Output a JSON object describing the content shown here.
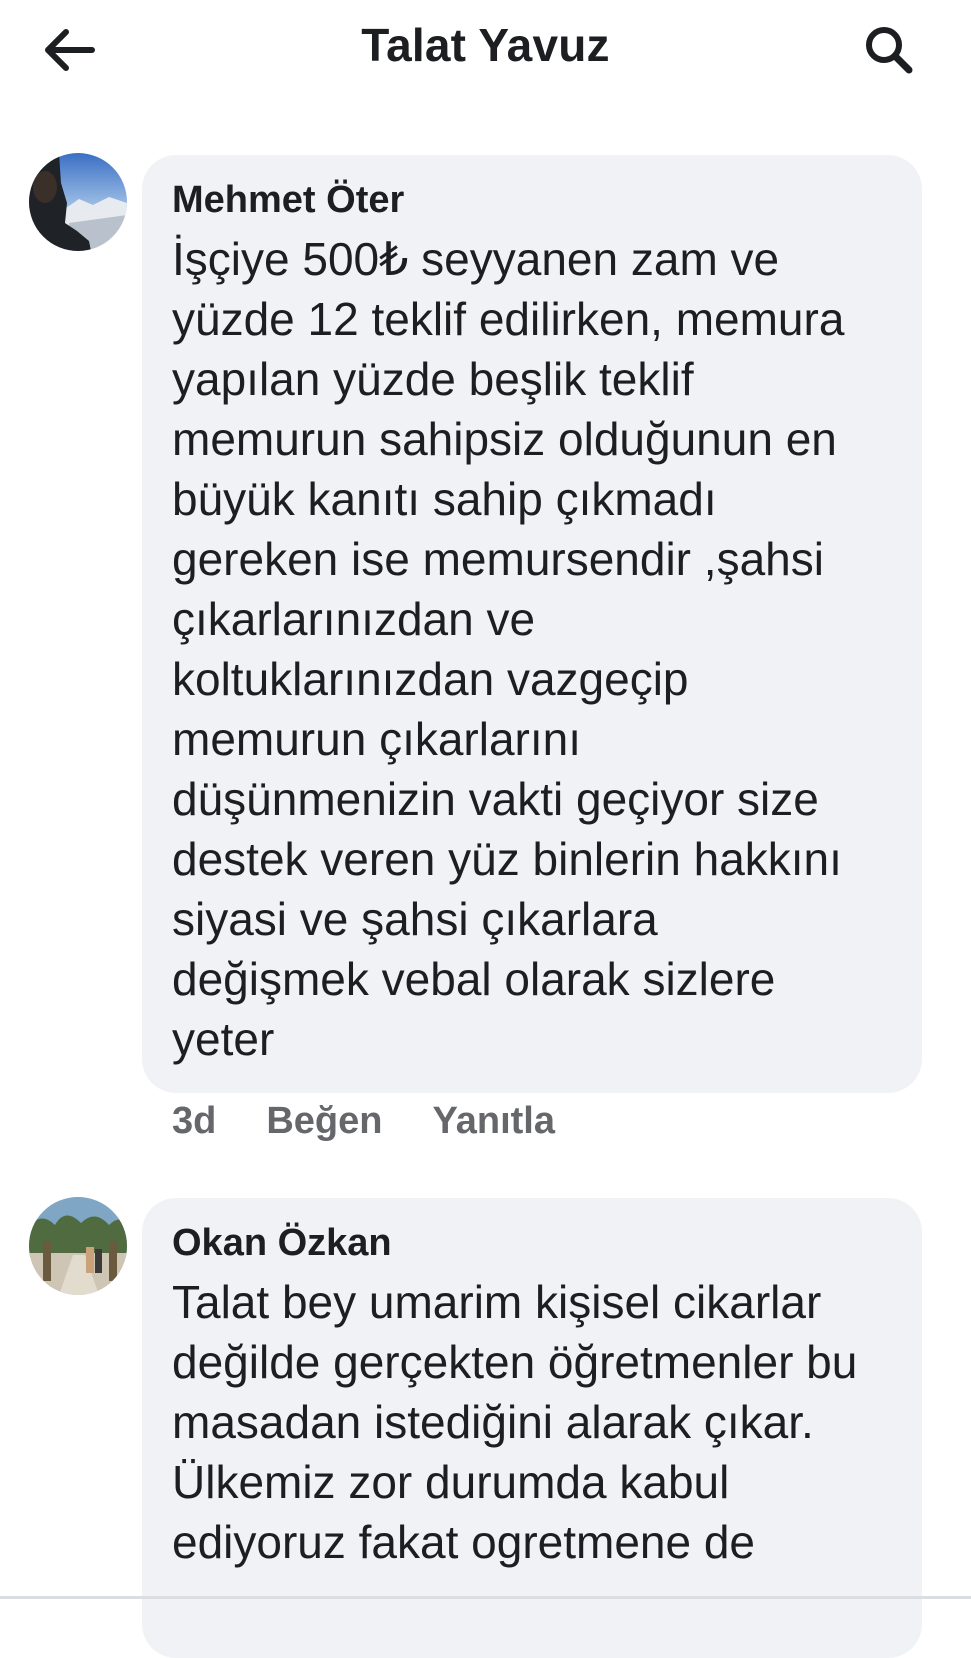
{
  "header": {
    "title": "Talat Yavuz",
    "back_icon": "arrow-left-icon",
    "search_icon": "search-icon"
  },
  "comments": [
    {
      "author": "Mehmet Öter",
      "text": "İşçiye 500₺ seyyanen zam ve\nyüzde 12 teklif edilirken, memura\nyapılan  yüzde beşlik teklif\nmemurun sahipsiz olduğunun en\nbüyük kanıtı sahip çıkmadı\ngereken ise memursendir ,şahsi\nçıkarlarınızdan ve\nkoltuklarınızdan vazgeçip\nmemurun çıkarlarını\ndüşünmenizin vakti geçiyor size\ndestek veren yüz binlerin hakkını\nsiyasi ve şahsi çıkarlara\ndeğişmek vebal olarak sizlere\nyeter",
      "time": "3d",
      "like_label": "Beğen",
      "reply_label": "Yanıtla"
    },
    {
      "author": "Okan Özkan",
      "text": "Talat bey umarim kişisel cikarlar\ndeğilde gerçekten öğretmenler bu\nmasadan istediğini alarak çıkar.\nÜlkemiz zor durumda kabul\nediyoruz fakat ogretmene de"
    }
  ],
  "colors": {
    "bubble_bg": "#f0f2f5",
    "text": "#1c1e21",
    "secondary_text": "#65676b"
  }
}
